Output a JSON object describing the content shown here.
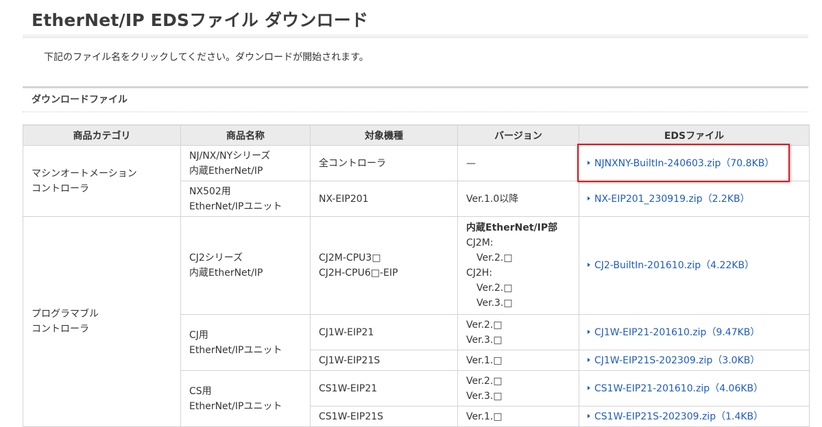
{
  "page": {
    "title": "EtherNet/IP EDSファイル ダウンロード",
    "intro": "下記のファイル名をクリックしてください。ダウンロードが開始されます。",
    "section_heading": "ダウンロードファイル"
  },
  "table": {
    "headers": [
      "商品カテゴリ",
      "商品名称",
      "対象機種",
      "バージョン",
      "EDSファイル"
    ],
    "categories": {
      "machine_automation": [
        "マシンオートメーション",
        "コントローラ"
      ],
      "programmable": [
        "プログラマブル",
        "コントローラ"
      ]
    },
    "rows": {
      "njnxny": {
        "name": [
          "NJ/NX/NYシリーズ",
          "内蔵EtherNet/IP"
        ],
        "model": "全コントローラ",
        "version": "—",
        "file": "NJNXNY-BuiltIn-240603.zip（70.8KB）"
      },
      "nx502": {
        "name": [
          "NX502用",
          "EtherNet/IPユニット"
        ],
        "model": "NX-EIP201",
        "version": "Ver.1.0以降",
        "file": "NX-EIP201_230919.zip（2.2KB）"
      },
      "cj2": {
        "name": [
          "CJ2シリーズ",
          "内蔵EtherNet/IP"
        ],
        "model": [
          "CJ2M-CPU3□",
          "CJ2H-CPU6□-EIP"
        ],
        "version": {
          "heading": "内蔵EtherNet/IP部",
          "lines": [
            "CJ2M:",
            "Ver.2.□",
            "CJ2H:",
            "Ver.2.□",
            "Ver.3.□"
          ]
        },
        "file": "CJ2-BuiltIn-201610.zip（4.22KB）"
      },
      "cj_unit": {
        "name": [
          "CJ用",
          "EtherNet/IPユニット"
        ],
        "sub": [
          {
            "model": "CJ1W-EIP21",
            "version": [
              "Ver.2.□",
              "Ver.3.□"
            ],
            "file": "CJ1W-EIP21-201610.zip（9.47KB）"
          },
          {
            "model": "CJ1W-EIP21S",
            "version": [
              "Ver.1.□"
            ],
            "file": "CJ1W-EIP21S-202309.zip（3.0KB）"
          }
        ]
      },
      "cs_unit": {
        "name": [
          "CS用",
          "EtherNet/IPユニット"
        ],
        "sub": [
          {
            "model": "CS1W-EIP21",
            "version": [
              "Ver.2.□",
              "Ver.3.□"
            ],
            "file": "CS1W-EIP21-201610.zip（4.06KB）"
          },
          {
            "model": "CS1W-EIP21S",
            "version": [
              "Ver.1.□"
            ],
            "file": "CS1W-EIP21S-202309.zip（1.4KB）"
          }
        ]
      }
    }
  },
  "colors": {
    "link": "#1f5cbf",
    "highlight_border": "#e0181e",
    "header_bg": "#ebebeb",
    "border": "#d3d3d3"
  }
}
